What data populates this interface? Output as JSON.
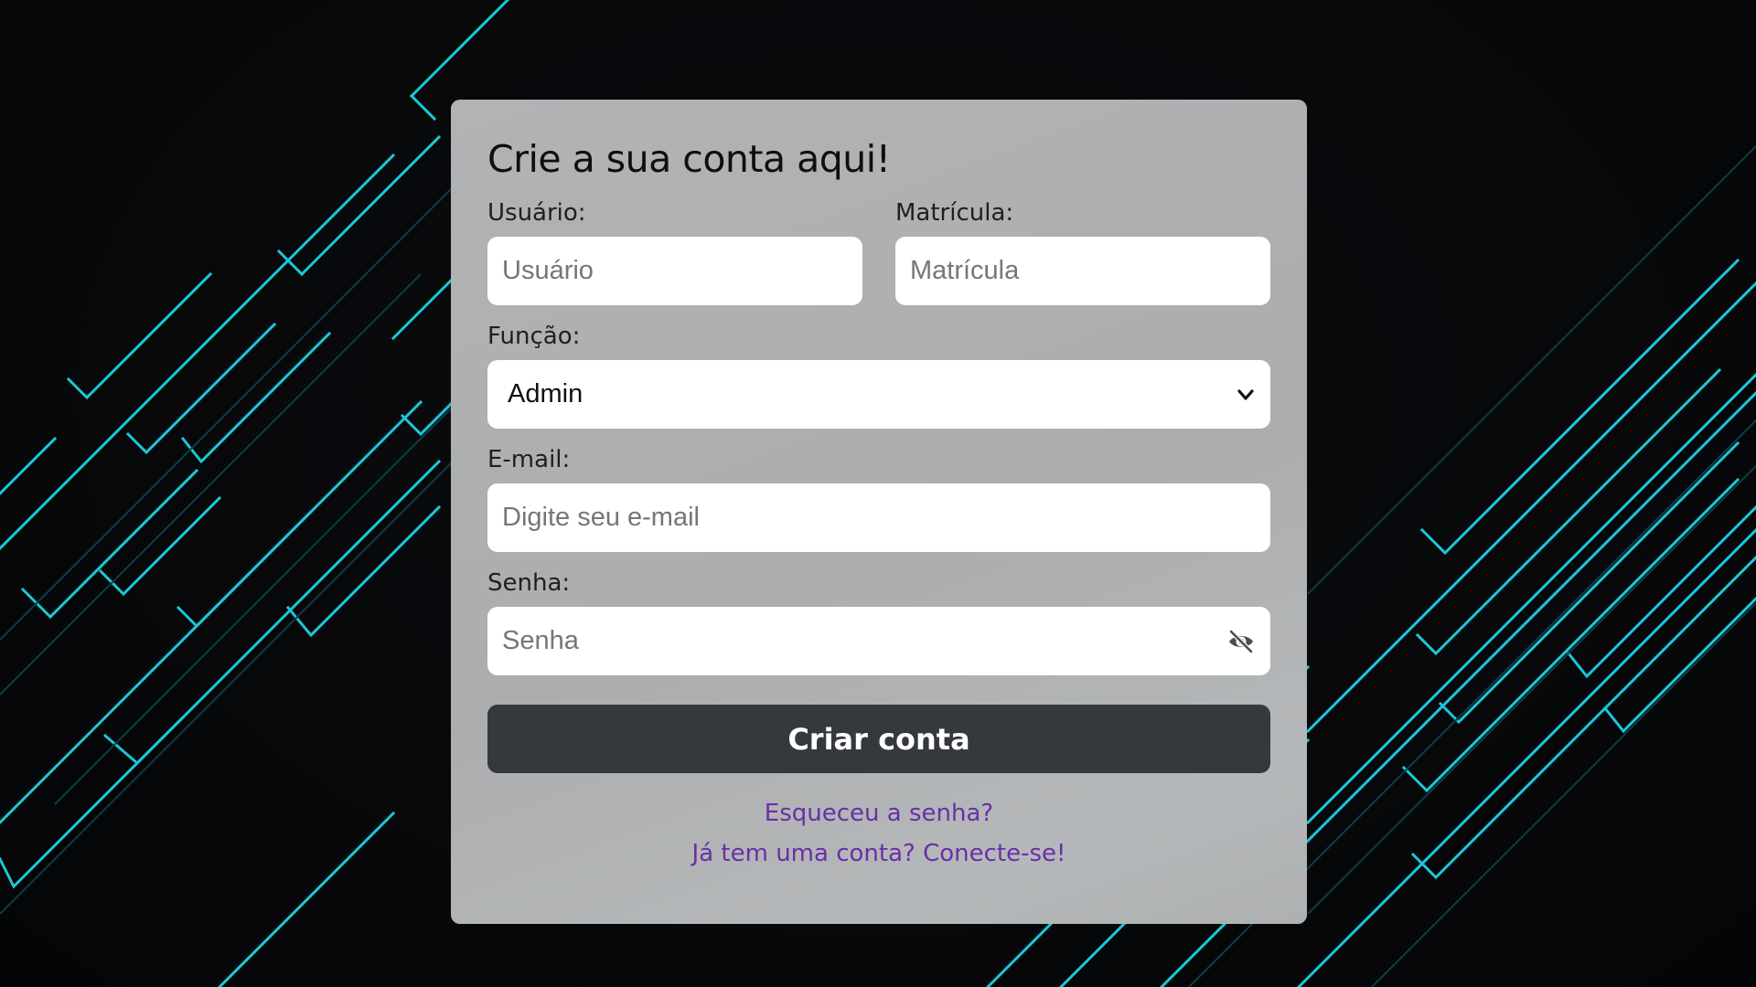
{
  "form": {
    "title": "Crie a sua conta aqui!",
    "usuario": {
      "label": "Usuário:",
      "placeholder": "Usuário"
    },
    "matricula": {
      "label": "Matrícula:",
      "placeholder": "Matrícula"
    },
    "funcao": {
      "label": "Função:",
      "selected": "Admin"
    },
    "email": {
      "label": "E-mail:",
      "placeholder": "Digite seu e-mail"
    },
    "senha": {
      "label": "Senha:",
      "placeholder": "Senha"
    },
    "submit_label": "Criar conta",
    "forgot_link": "Esqueceu a senha?",
    "login_link": "Já tem uma conta? Conecte-se!"
  },
  "icons": {
    "dropdown": "chevron-down-icon",
    "password_toggle": "eye-slash-icon"
  },
  "colors": {
    "background": "#08090b",
    "card": "#b0b1b2",
    "accent_lines": "#19c3d3",
    "button": "#35383d",
    "link": "#6a2fa6"
  }
}
